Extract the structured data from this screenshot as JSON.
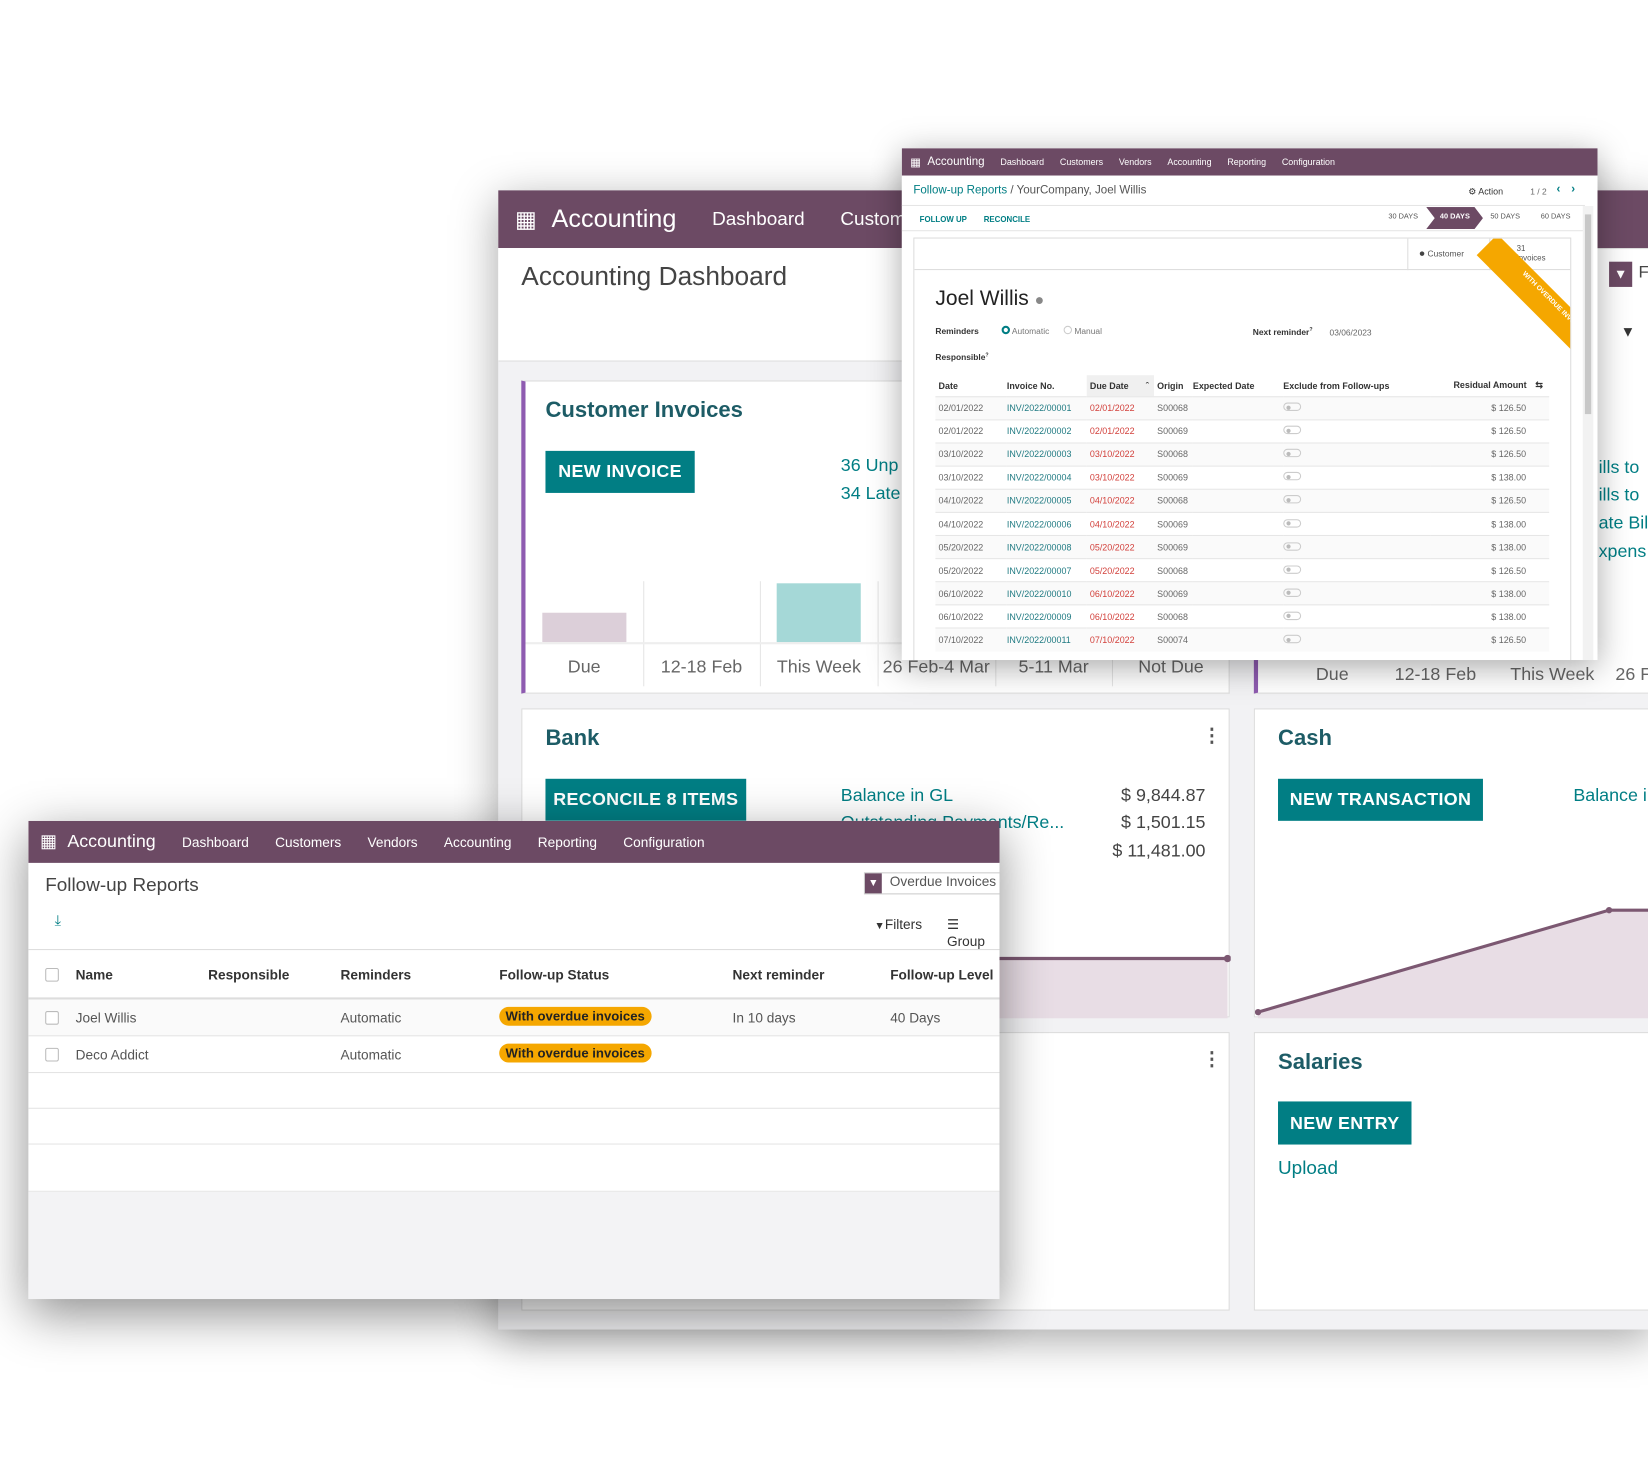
{
  "colors": {
    "navbar": "#6c4a64",
    "accent": "#017e84",
    "overdue_red": "#d23f3a",
    "badge_orange": "#f5a700"
  },
  "dashboard": {
    "nav": {
      "app": "Accounting",
      "items": [
        "Dashboard",
        "Custome"
      ]
    },
    "title": "Accounting Dashboard",
    "customer_invoices": {
      "title": "Customer Invoices",
      "button": "NEW INVOICE",
      "stats": [
        "36 Unp",
        "34 Late"
      ],
      "chart": {
        "labels": [
          "Due",
          "12-18 Feb",
          "This Week",
          "26 Feb-4 Mar",
          "5-11 Mar",
          "Not Due"
        ],
        "bar_levels": [
          0.5,
          0,
          1,
          0,
          0,
          0
        ]
      }
    },
    "bank": {
      "title": "Bank",
      "button": "RECONCILE 8 ITEMS",
      "rows": [
        {
          "label": "Balance in GL",
          "value": "$ 9,844.87"
        },
        {
          "label": "Outstanding Payments/Re...",
          "value": "$ 1,501.15"
        },
        {
          "label": "",
          "value": "$ 11,481.00"
        }
      ]
    },
    "cash": {
      "title": "Cash",
      "button": "NEW TRANSACTION",
      "balance_label": "Balance i"
    },
    "salaries": {
      "title": "Salaries",
      "button": "NEW ENTRY",
      "link": "Upload"
    },
    "vendor_bills": {
      "filter_label": "F",
      "lines": [
        "ills to",
        "ills to",
        "ate Bil",
        "xpens"
      ],
      "chart_labels": [
        "Due",
        "12-18 Feb",
        "This Week",
        "26 F"
      ]
    }
  },
  "followup_form": {
    "nav": {
      "app": "Accounting",
      "items": [
        "Dashboard",
        "Customers",
        "Vendors",
        "Accounting",
        "Reporting",
        "Configuration"
      ]
    },
    "breadcrumb": {
      "parent": "Follow-up Reports",
      "current": "YourCompany, Joel Willis"
    },
    "action": "Action",
    "pager": "1 / 2",
    "buttons": [
      "FOLLOW UP",
      "RECONCILE"
    ],
    "stages": [
      "30 DAYS",
      "40 DAYS",
      "50 DAYS",
      "60 DAYS"
    ],
    "active_stage": "40 DAYS",
    "smart_buttons": {
      "customer": "Customer",
      "invoices_count": "31",
      "invoices_label": "Invoices"
    },
    "ribbon": "WITH OVERDUE INVOICES",
    "partner": "Joel Willis",
    "reminders_label": "Reminders",
    "reminder_options": [
      "Automatic",
      "Manual"
    ],
    "reminder_selected": "Automatic",
    "next_reminder_label": "Next reminder",
    "next_reminder_value": "03/06/2023",
    "responsible_label": "Responsible",
    "columns": [
      "Date",
      "Invoice No.",
      "Due Date",
      "Origin",
      "Expected Date",
      "Exclude from Follow-ups",
      "Residual Amount"
    ],
    "rows": [
      {
        "date": "02/01/2022",
        "invoice": "INV/2022/00001",
        "due": "02/01/2022",
        "origin": "S00068",
        "amount": "$ 126.50"
      },
      {
        "date": "02/01/2022",
        "invoice": "INV/2022/00002",
        "due": "02/01/2022",
        "origin": "S00069",
        "amount": "$ 126.50"
      },
      {
        "date": "03/10/2022",
        "invoice": "INV/2022/00003",
        "due": "03/10/2022",
        "origin": "S00068",
        "amount": "$ 126.50"
      },
      {
        "date": "03/10/2022",
        "invoice": "INV/2022/00004",
        "due": "03/10/2022",
        "origin": "S00069",
        "amount": "$ 138.00"
      },
      {
        "date": "04/10/2022",
        "invoice": "INV/2022/00005",
        "due": "04/10/2022",
        "origin": "S00068",
        "amount": "$ 126.50"
      },
      {
        "date": "04/10/2022",
        "invoice": "INV/2022/00006",
        "due": "04/10/2022",
        "origin": "S00069",
        "amount": "$ 138.00"
      },
      {
        "date": "05/20/2022",
        "invoice": "INV/2022/00008",
        "due": "05/20/2022",
        "origin": "S00069",
        "amount": "$ 138.00"
      },
      {
        "date": "05/20/2022",
        "invoice": "INV/2022/00007",
        "due": "05/20/2022",
        "origin": "S00068",
        "amount": "$ 126.50"
      },
      {
        "date": "06/10/2022",
        "invoice": "INV/2022/00010",
        "due": "06/10/2022",
        "origin": "S00069",
        "amount": "$ 138.00"
      },
      {
        "date": "06/10/2022",
        "invoice": "INV/2022/00009",
        "due": "06/10/2022",
        "origin": "S00068",
        "amount": "$ 138.00"
      },
      {
        "date": "07/10/2022",
        "invoice": "INV/2022/00011",
        "due": "07/10/2022",
        "origin": "S00074",
        "amount": "$ 126.50"
      }
    ]
  },
  "followup_list": {
    "nav": {
      "app": "Accounting",
      "items": [
        "Dashboard",
        "Customers",
        "Vendors",
        "Accounting",
        "Reporting",
        "Configuration"
      ]
    },
    "title": "Follow-up Reports",
    "facet": "Overdue Invoices",
    "filters": "Filters",
    "group": "Group",
    "columns": [
      "Name",
      "Responsible",
      "Reminders",
      "Follow-up Status",
      "Next reminder",
      "Follow-up Level"
    ],
    "rows": [
      {
        "name": "Joel Willis",
        "responsible": "",
        "reminders": "Automatic",
        "status": "With overdue invoices",
        "next": "In 10 days",
        "level": "40 Days"
      },
      {
        "name": "Deco Addict",
        "responsible": "",
        "reminders": "Automatic",
        "status": "With overdue invoices",
        "next": "",
        "level": ""
      }
    ]
  }
}
